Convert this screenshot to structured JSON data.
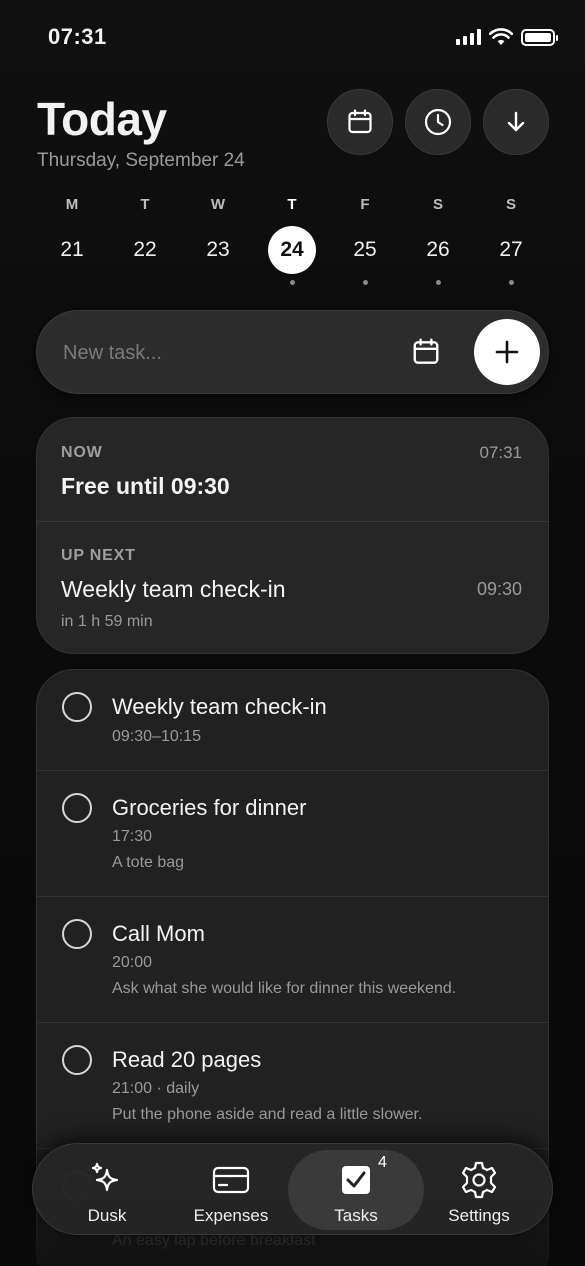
{
  "status": {
    "time": "07:31"
  },
  "header": {
    "title": "Today",
    "date": "Thursday, September 24"
  },
  "header_buttons": [
    {
      "icon": "calendar-icon"
    },
    {
      "icon": "clock-icon"
    },
    {
      "icon": "arrow-down-icon"
    }
  ],
  "week": [
    {
      "letter": "M",
      "num": "21",
      "dot": false
    },
    {
      "letter": "T",
      "num": "22",
      "dot": false
    },
    {
      "letter": "W",
      "num": "23",
      "dot": false
    },
    {
      "letter": "T",
      "num": "24",
      "dot": true,
      "selected": true
    },
    {
      "letter": "F",
      "num": "25",
      "dot": true
    },
    {
      "letter": "S",
      "num": "26",
      "dot": true
    },
    {
      "letter": "S",
      "num": "27",
      "dot": true
    }
  ],
  "new_task": {
    "placeholder": "New task..."
  },
  "now_card": {
    "now_label": "NOW",
    "now_time": "07:31",
    "now_title": "Free until 09:30",
    "next_label": "UP NEXT",
    "next_title": "Weekly team check-in",
    "next_time": "09:30",
    "next_in": "in 1 h 59 min"
  },
  "tasks": [
    {
      "title": "Weekly team check-in",
      "meta": "09:30–10:15",
      "note": ""
    },
    {
      "title": "Groceries for dinner",
      "meta": "17:30",
      "note": "A tote bag"
    },
    {
      "title": "Call Mom",
      "meta": "20:00",
      "note": "Ask what she would like for dinner this weekend."
    },
    {
      "title": "Read 20 pages",
      "meta": "21:00 · daily",
      "note": "Put the phone aside and read a little slower."
    },
    {
      "title": "",
      "meta": "",
      "note": "An easy lap before breakfast"
    }
  ],
  "tabs": [
    {
      "label": "Dusk",
      "icon": "sparkles-icon"
    },
    {
      "label": "Expenses",
      "icon": "card-icon"
    },
    {
      "label": "Tasks",
      "icon": "checkbox-icon",
      "badge": "4",
      "active": true
    },
    {
      "label": "Settings",
      "icon": "gear-icon"
    }
  ]
}
